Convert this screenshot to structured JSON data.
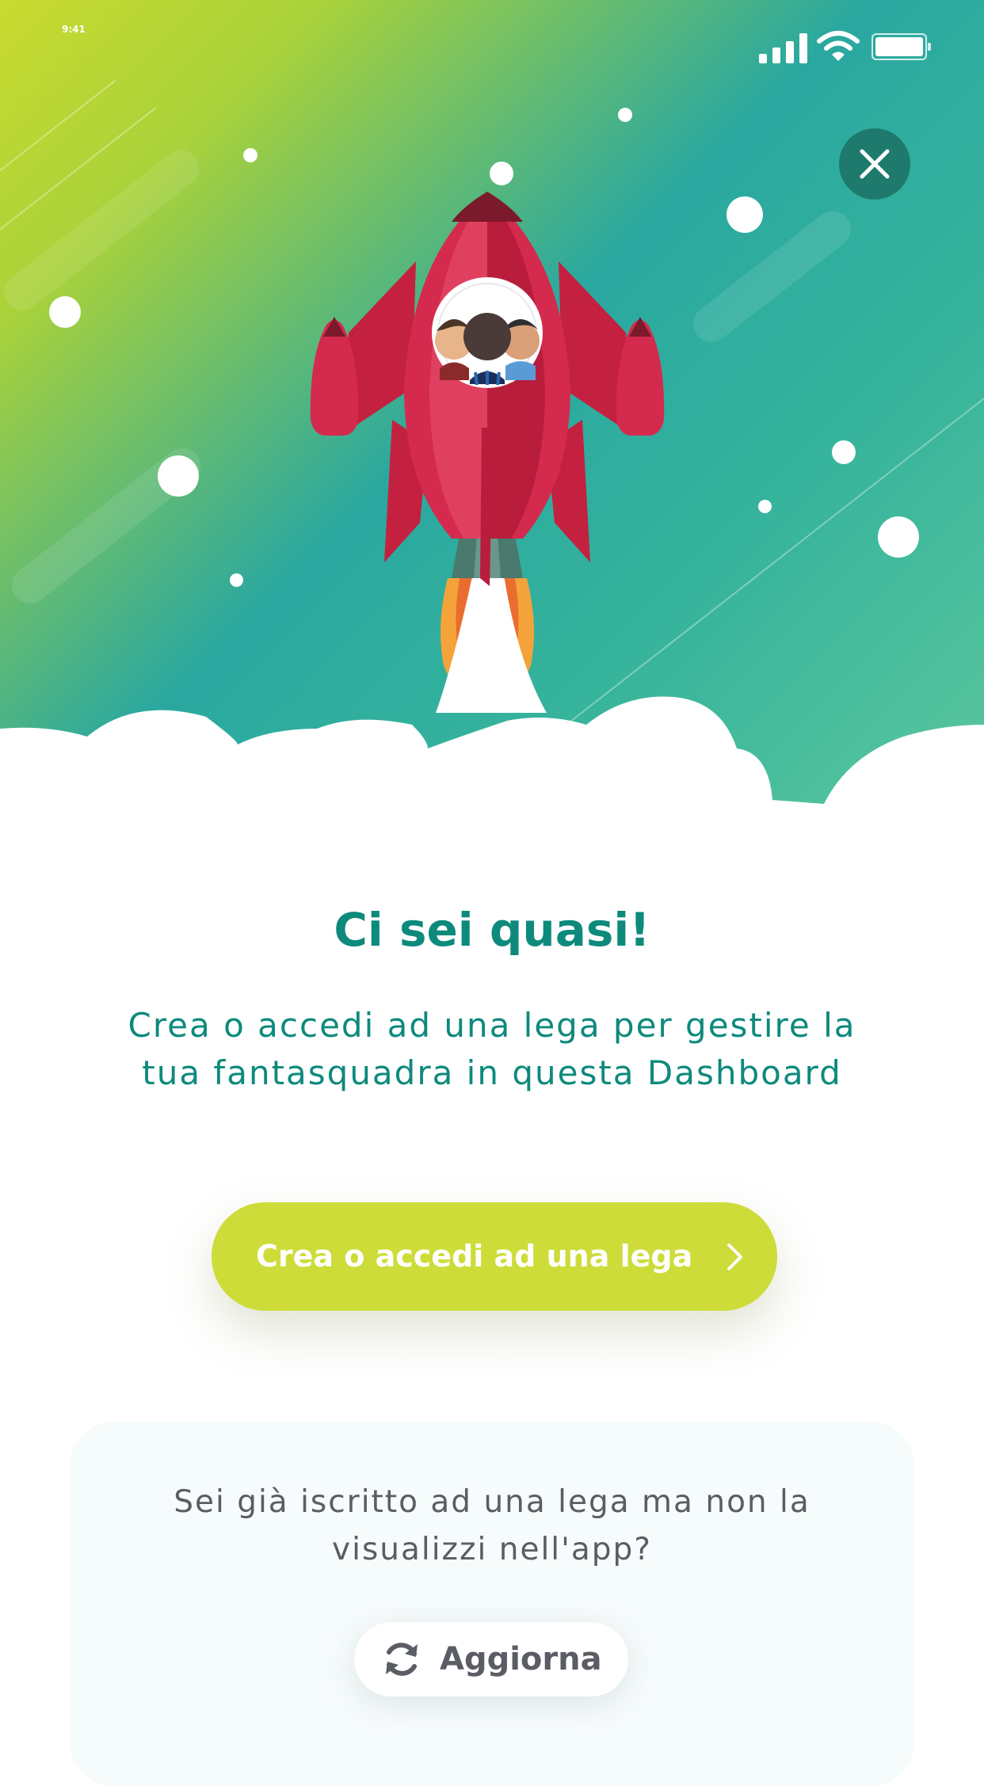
{
  "status_bar": {
    "time": "9:41",
    "signal_icon": "cellular-signal-icon",
    "wifi_icon": "wifi-icon",
    "battery_icon": "battery-icon"
  },
  "hero": {
    "close_icon": "close-icon",
    "illustration": "rocket-launch-illustration",
    "avatars_icon": "player-avatars-icon"
  },
  "content": {
    "title": "Ci sei quasi!",
    "subtitle_line1": "Crea o accedi ad una lega per gestire la",
    "subtitle_line2": "tua fantasquadra in questa Dashboard",
    "cta_label": "Crea o accedi ad una lega",
    "cta_icon": "chevron-right-icon"
  },
  "info_card": {
    "text_line1": "Sei già iscritto ad una lega ma non la",
    "text_line2": "visualizzi nell'app?",
    "refresh_label": "Aggiorna",
    "refresh_icon": "refresh-icon"
  },
  "colors": {
    "primary_teal": "#0d8a7c",
    "cta_lime": "#cddc39",
    "close_button": "#1f7a6e",
    "rocket_red": "#d42a4d"
  }
}
